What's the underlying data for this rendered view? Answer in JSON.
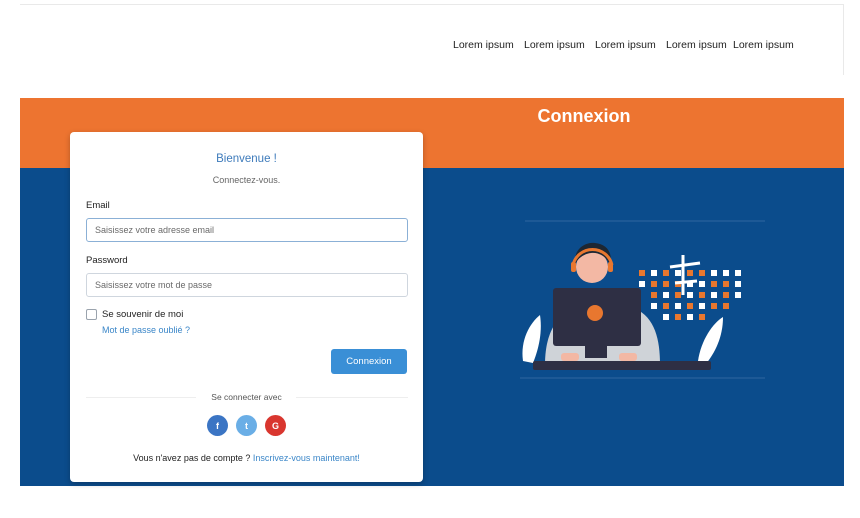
{
  "nav": {
    "items": [
      "Lorem ipsum",
      "Lorem ipsum",
      "Lorem ipsum",
      "Lorem ipsum",
      "Lorem ipsum"
    ]
  },
  "banner": {
    "title": "Connexion"
  },
  "login": {
    "welcome": "Bienvenue !",
    "subtitle": "Connectez-vous.",
    "email_label": "Email",
    "email_placeholder": "Saisissez votre adresse email",
    "password_label": "Password",
    "password_placeholder": "Saisissez votre mot de passe",
    "remember_label": "Se souvenir de moi",
    "forgot_link": "Mot de passe oublié ?",
    "submit_label": "Connexion",
    "social_divider": "Se connecter avec",
    "social": [
      {
        "icon": "facebook-icon",
        "glyph": "f",
        "color": "#3b75c4"
      },
      {
        "icon": "twitter-icon",
        "glyph": "t",
        "color": "#6aaee6"
      },
      {
        "icon": "google-icon",
        "glyph": "G",
        "color": "#d9362f"
      }
    ],
    "signup_text": "Vous n'avez pas de compte ?",
    "signup_link": "Inscrivez-vous maintenant!"
  },
  "colors": {
    "banner": "#ed7430",
    "main": "#0b4c8c",
    "accent": "#3a8fd6"
  }
}
